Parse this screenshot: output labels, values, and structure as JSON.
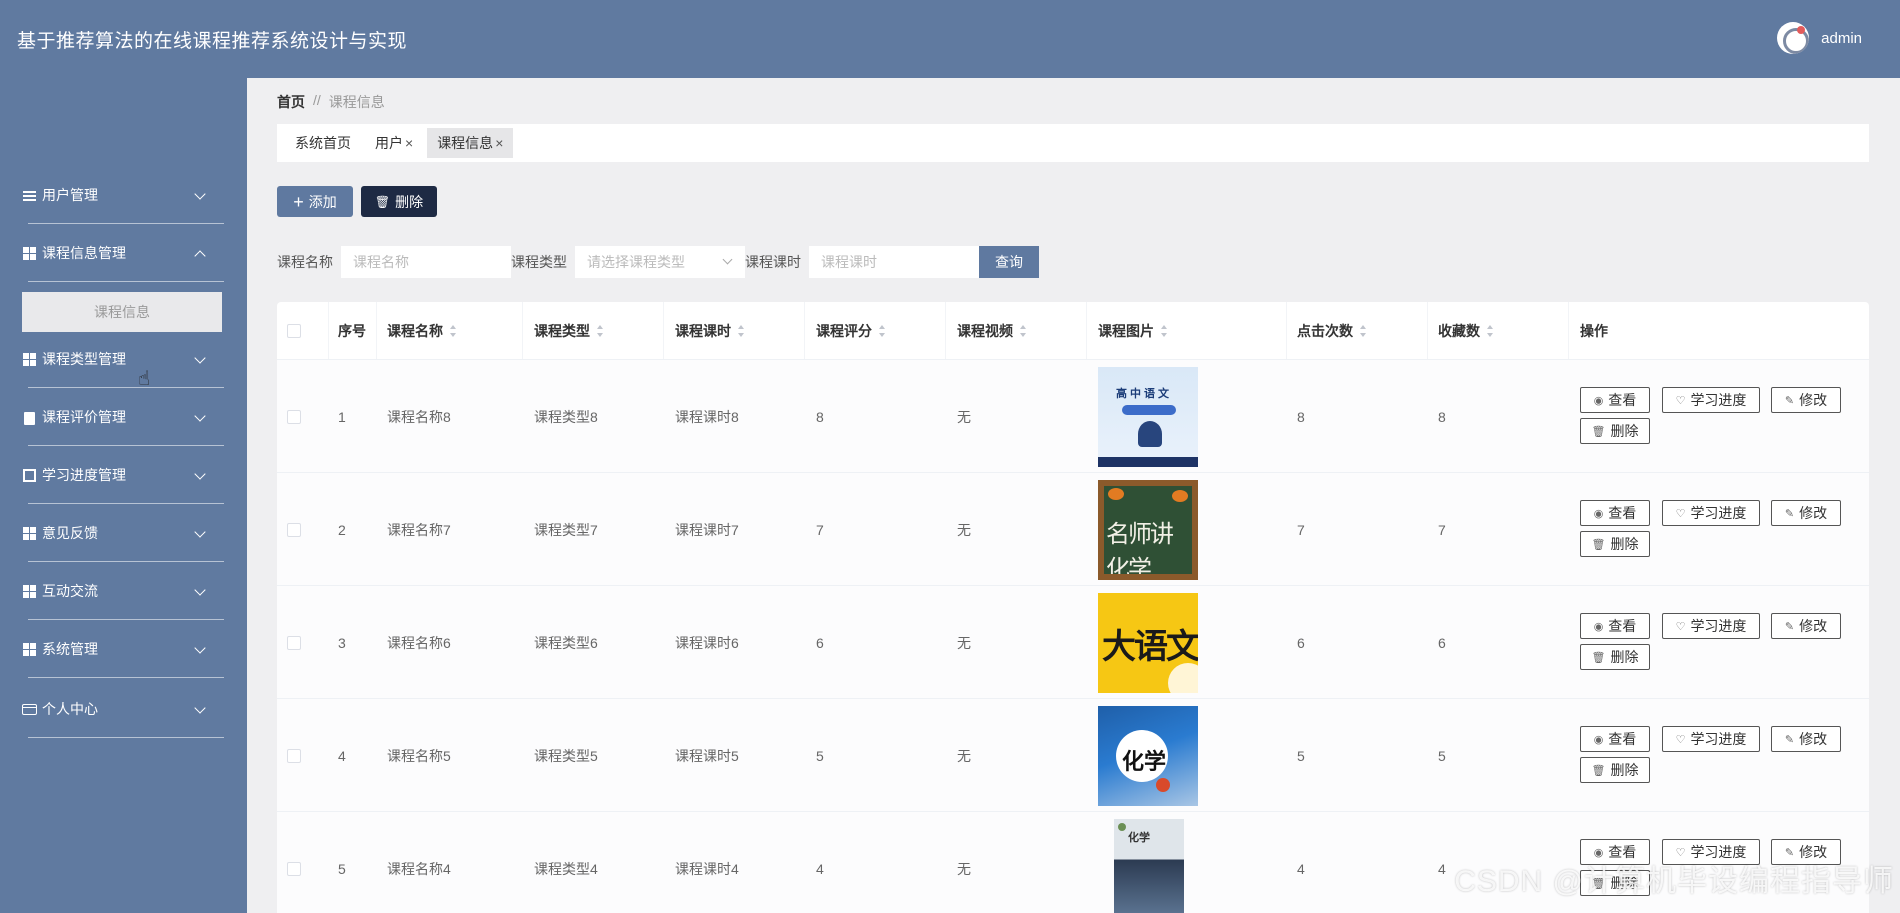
{
  "header": {
    "title": "基于推荐算法的在线课程推荐系统设计与实现",
    "user": "admin"
  },
  "sidebar": {
    "items": [
      {
        "label": "用户管理",
        "icon": "sliders-icon",
        "expanded": false
      },
      {
        "label": "课程信息管理",
        "icon": "grid-icon",
        "expanded": true
      },
      {
        "label": "课程类型管理",
        "icon": "grid-icon",
        "expanded": false
      },
      {
        "label": "课程评价管理",
        "icon": "clipboard-icon",
        "expanded": false
      },
      {
        "label": "学习进度管理",
        "icon": "chart-icon",
        "expanded": false
      },
      {
        "label": "意见反馈",
        "icon": "grid-icon",
        "expanded": false
      },
      {
        "label": "互动交流",
        "icon": "grid-icon",
        "expanded": false
      },
      {
        "label": "系统管理",
        "icon": "grid-icon",
        "expanded": false
      },
      {
        "label": "个人中心",
        "icon": "card-icon",
        "expanded": false
      }
    ],
    "submenu": {
      "label": "课程信息"
    }
  },
  "breadcrumb": {
    "home": "首页",
    "separator": "//",
    "current": "课程信息"
  },
  "tabs": [
    {
      "label": "系统首页",
      "closable": false
    },
    {
      "label": "用户",
      "closable": true
    },
    {
      "label": "课程信息",
      "closable": true,
      "active": true
    }
  ],
  "tab_close": "×",
  "toolbar": {
    "add_label": "添加",
    "delete_label": "删除"
  },
  "search": {
    "name_label": "课程名称",
    "name_placeholder": "课程名称",
    "type_label": "课程类型",
    "type_placeholder": "请选择课程类型",
    "hours_label": "课程课时",
    "hours_placeholder": "课程课时",
    "query_label": "查询"
  },
  "table": {
    "headers": {
      "index": "序号",
      "name": "课程名称",
      "type": "课程类型",
      "hours": "课程课时",
      "rating": "课程评分",
      "video": "课程视频",
      "image": "课程图片",
      "clicks": "点击次数",
      "favorites": "收藏数",
      "actions": "操作"
    },
    "rows": [
      {
        "index": "1",
        "name": "课程名称8",
        "type": "课程类型8",
        "hours": "课程课时8",
        "rating": "8",
        "video": "无",
        "image_text": "高中语文",
        "clicks": "8",
        "favorites": "8"
      },
      {
        "index": "2",
        "name": "课程名称7",
        "type": "课程类型7",
        "hours": "课程课时7",
        "rating": "7",
        "video": "无",
        "image_text": "名师讲化学",
        "clicks": "7",
        "favorites": "7"
      },
      {
        "index": "3",
        "name": "课程名称6",
        "type": "课程类型6",
        "hours": "课程课时6",
        "rating": "6",
        "video": "无",
        "image_text": "大语文",
        "clicks": "6",
        "favorites": "6"
      },
      {
        "index": "4",
        "name": "课程名称5",
        "type": "课程类型5",
        "hours": "课程课时5",
        "rating": "5",
        "video": "无",
        "image_text": "化学",
        "clicks": "5",
        "favorites": "5"
      },
      {
        "index": "5",
        "name": "课程名称4",
        "type": "课程类型4",
        "hours": "课程课时4",
        "rating": "4",
        "video": "无",
        "image_text": "化学",
        "clicks": "4",
        "favorites": "4"
      }
    ],
    "actions": {
      "view": "查看",
      "progress": "学习进度",
      "edit": "修改",
      "delete": "删除"
    }
  },
  "watermark": "CSDN @计算机毕设编程指导师",
  "colors": {
    "primary": "#607aa0",
    "dark_button": "#1e2a44"
  }
}
